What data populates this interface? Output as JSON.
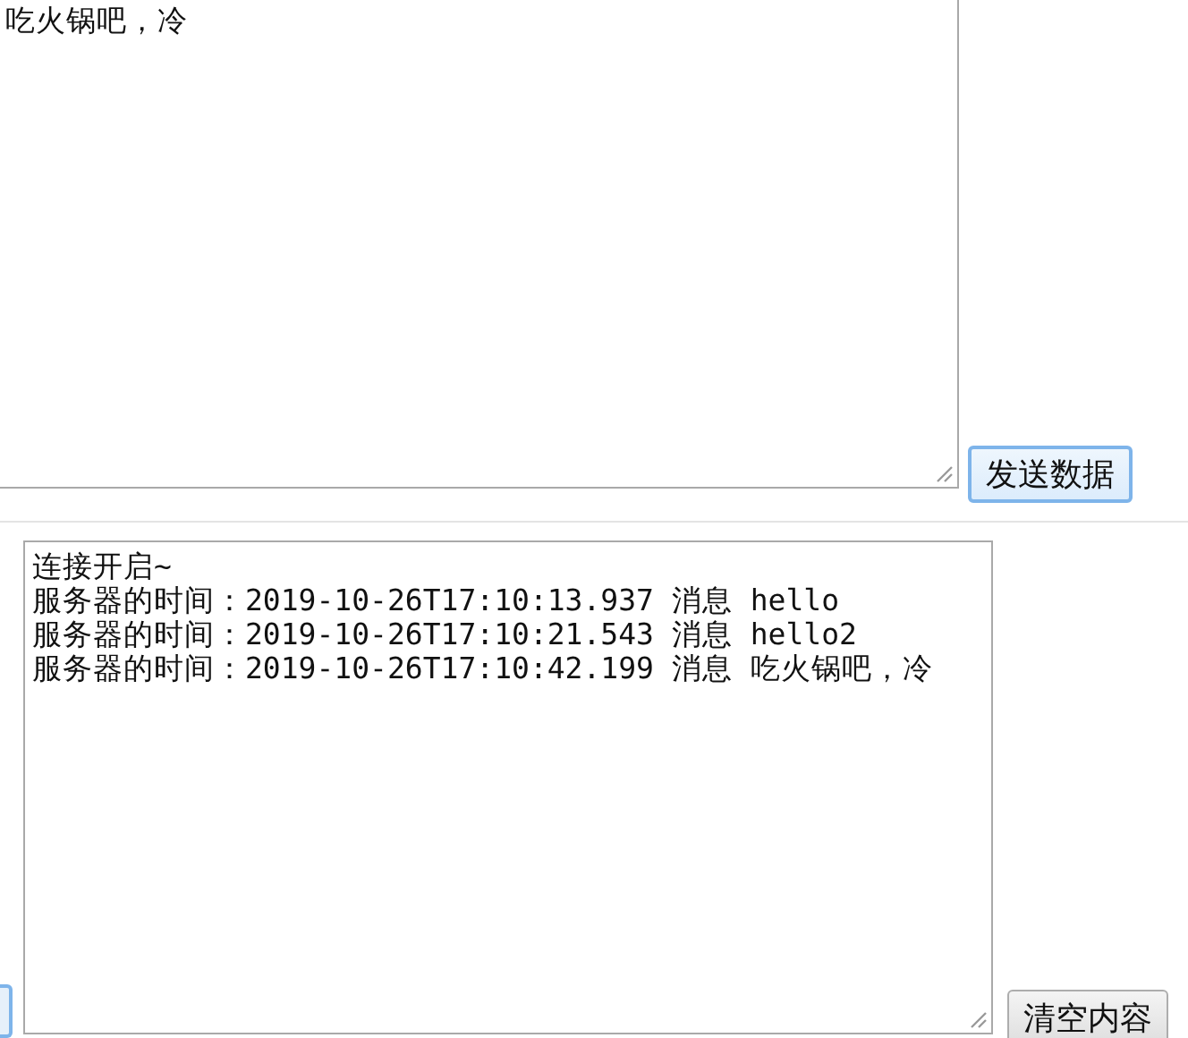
{
  "send_panel": {
    "input_lines": [
      "吃火锅吧，冷"
    ],
    "send_button": "发送数据"
  },
  "log_panel": {
    "lines": [
      "连接开启~",
      "服务器的时间：2019-10-26T17:10:13.937 消息 hello",
      "服务器的时间：2019-10-26T17:10:21.543 消息 hello2",
      "服务器的时间：2019-10-26T17:10:42.199 消息 吃火锅吧，冷"
    ],
    "clear_button": "清空内容"
  }
}
